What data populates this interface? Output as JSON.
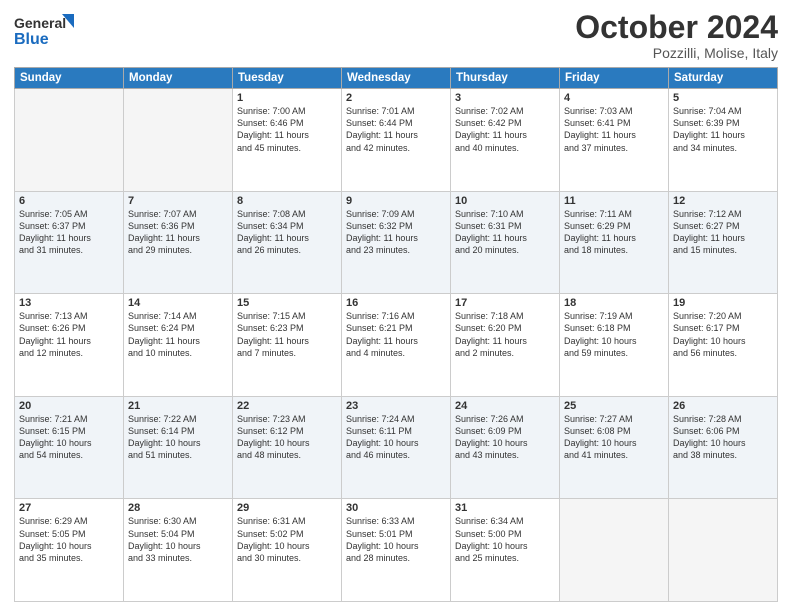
{
  "header": {
    "logo_line1": "General",
    "logo_line2": "Blue",
    "title": "October 2024",
    "location": "Pozzilli, Molise, Italy"
  },
  "days_of_week": [
    "Sunday",
    "Monday",
    "Tuesday",
    "Wednesday",
    "Thursday",
    "Friday",
    "Saturday"
  ],
  "weeks": [
    [
      {
        "day": "",
        "info": ""
      },
      {
        "day": "",
        "info": ""
      },
      {
        "day": "1",
        "info": "Sunrise: 7:00 AM\nSunset: 6:46 PM\nDaylight: 11 hours\nand 45 minutes."
      },
      {
        "day": "2",
        "info": "Sunrise: 7:01 AM\nSunset: 6:44 PM\nDaylight: 11 hours\nand 42 minutes."
      },
      {
        "day": "3",
        "info": "Sunrise: 7:02 AM\nSunset: 6:42 PM\nDaylight: 11 hours\nand 40 minutes."
      },
      {
        "day": "4",
        "info": "Sunrise: 7:03 AM\nSunset: 6:41 PM\nDaylight: 11 hours\nand 37 minutes."
      },
      {
        "day": "5",
        "info": "Sunrise: 7:04 AM\nSunset: 6:39 PM\nDaylight: 11 hours\nand 34 minutes."
      }
    ],
    [
      {
        "day": "6",
        "info": "Sunrise: 7:05 AM\nSunset: 6:37 PM\nDaylight: 11 hours\nand 31 minutes."
      },
      {
        "day": "7",
        "info": "Sunrise: 7:07 AM\nSunset: 6:36 PM\nDaylight: 11 hours\nand 29 minutes."
      },
      {
        "day": "8",
        "info": "Sunrise: 7:08 AM\nSunset: 6:34 PM\nDaylight: 11 hours\nand 26 minutes."
      },
      {
        "day": "9",
        "info": "Sunrise: 7:09 AM\nSunset: 6:32 PM\nDaylight: 11 hours\nand 23 minutes."
      },
      {
        "day": "10",
        "info": "Sunrise: 7:10 AM\nSunset: 6:31 PM\nDaylight: 11 hours\nand 20 minutes."
      },
      {
        "day": "11",
        "info": "Sunrise: 7:11 AM\nSunset: 6:29 PM\nDaylight: 11 hours\nand 18 minutes."
      },
      {
        "day": "12",
        "info": "Sunrise: 7:12 AM\nSunset: 6:27 PM\nDaylight: 11 hours\nand 15 minutes."
      }
    ],
    [
      {
        "day": "13",
        "info": "Sunrise: 7:13 AM\nSunset: 6:26 PM\nDaylight: 11 hours\nand 12 minutes."
      },
      {
        "day": "14",
        "info": "Sunrise: 7:14 AM\nSunset: 6:24 PM\nDaylight: 11 hours\nand 10 minutes."
      },
      {
        "day": "15",
        "info": "Sunrise: 7:15 AM\nSunset: 6:23 PM\nDaylight: 11 hours\nand 7 minutes."
      },
      {
        "day": "16",
        "info": "Sunrise: 7:16 AM\nSunset: 6:21 PM\nDaylight: 11 hours\nand 4 minutes."
      },
      {
        "day": "17",
        "info": "Sunrise: 7:18 AM\nSunset: 6:20 PM\nDaylight: 11 hours\nand 2 minutes."
      },
      {
        "day": "18",
        "info": "Sunrise: 7:19 AM\nSunset: 6:18 PM\nDaylight: 10 hours\nand 59 minutes."
      },
      {
        "day": "19",
        "info": "Sunrise: 7:20 AM\nSunset: 6:17 PM\nDaylight: 10 hours\nand 56 minutes."
      }
    ],
    [
      {
        "day": "20",
        "info": "Sunrise: 7:21 AM\nSunset: 6:15 PM\nDaylight: 10 hours\nand 54 minutes."
      },
      {
        "day": "21",
        "info": "Sunrise: 7:22 AM\nSunset: 6:14 PM\nDaylight: 10 hours\nand 51 minutes."
      },
      {
        "day": "22",
        "info": "Sunrise: 7:23 AM\nSunset: 6:12 PM\nDaylight: 10 hours\nand 48 minutes."
      },
      {
        "day": "23",
        "info": "Sunrise: 7:24 AM\nSunset: 6:11 PM\nDaylight: 10 hours\nand 46 minutes."
      },
      {
        "day": "24",
        "info": "Sunrise: 7:26 AM\nSunset: 6:09 PM\nDaylight: 10 hours\nand 43 minutes."
      },
      {
        "day": "25",
        "info": "Sunrise: 7:27 AM\nSunset: 6:08 PM\nDaylight: 10 hours\nand 41 minutes."
      },
      {
        "day": "26",
        "info": "Sunrise: 7:28 AM\nSunset: 6:06 PM\nDaylight: 10 hours\nand 38 minutes."
      }
    ],
    [
      {
        "day": "27",
        "info": "Sunrise: 6:29 AM\nSunset: 5:05 PM\nDaylight: 10 hours\nand 35 minutes."
      },
      {
        "day": "28",
        "info": "Sunrise: 6:30 AM\nSunset: 5:04 PM\nDaylight: 10 hours\nand 33 minutes."
      },
      {
        "day": "29",
        "info": "Sunrise: 6:31 AM\nSunset: 5:02 PM\nDaylight: 10 hours\nand 30 minutes."
      },
      {
        "day": "30",
        "info": "Sunrise: 6:33 AM\nSunset: 5:01 PM\nDaylight: 10 hours\nand 28 minutes."
      },
      {
        "day": "31",
        "info": "Sunrise: 6:34 AM\nSunset: 5:00 PM\nDaylight: 10 hours\nand 25 minutes."
      },
      {
        "day": "",
        "info": ""
      },
      {
        "day": "",
        "info": ""
      }
    ]
  ],
  "row_shading": [
    false,
    true,
    false,
    true,
    false
  ]
}
